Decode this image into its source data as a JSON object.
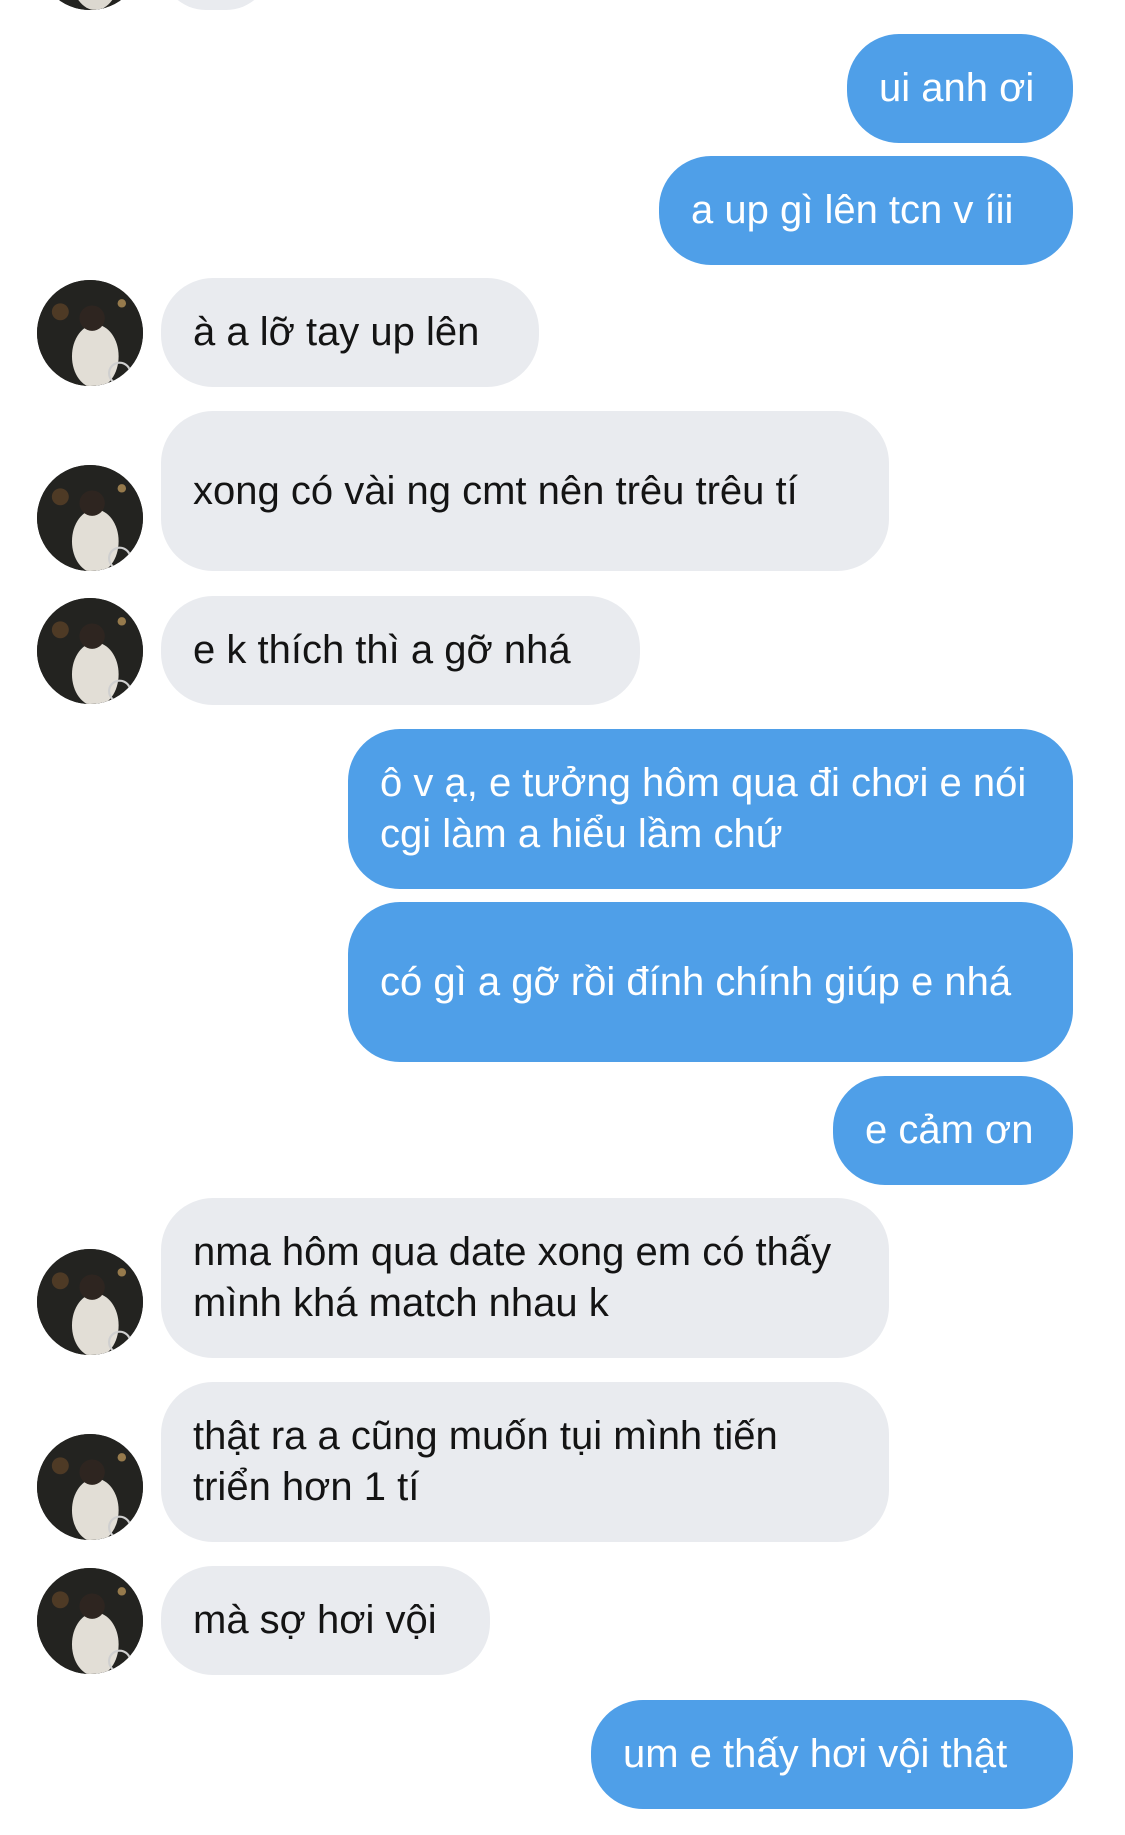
{
  "conversation": {
    "messages": [
      {
        "from": "me",
        "text": "ui anh ơi"
      },
      {
        "from": "me",
        "text": "a up gì lên tcn v íii"
      },
      {
        "from": "them",
        "text": "à a lỡ tay up lên"
      },
      {
        "from": "them",
        "text": "xong có vài ng cmt nên trêu trêu tí"
      },
      {
        "from": "them",
        "text": "e k thích thì a gỡ nhá"
      },
      {
        "from": "me",
        "text": "ô v ạ, e tưởng hôm qua đi chơi e nói cgi làm a hiểu lầm chứ"
      },
      {
        "from": "me",
        "text": "có gì a gỡ rồi đính chính giúp e nhá"
      },
      {
        "from": "me",
        "text": "e cảm ơn"
      },
      {
        "from": "them",
        "text": "nma hôm qua date xong em có thấy mình khá match nhau k"
      },
      {
        "from": "them",
        "text": "thật ra a cũng muốn tụi mình tiến triển hơn 1 tí"
      },
      {
        "from": "them",
        "text": "mà sợ hơi vội"
      },
      {
        "from": "me",
        "text": "um e thấy hơi vội thật"
      }
    ]
  },
  "colors": {
    "outgoing_bubble": "#4f9fe8",
    "incoming_bubble": "#e9ebef"
  },
  "icons": {
    "contact_avatar": "contact-avatar-photo"
  }
}
